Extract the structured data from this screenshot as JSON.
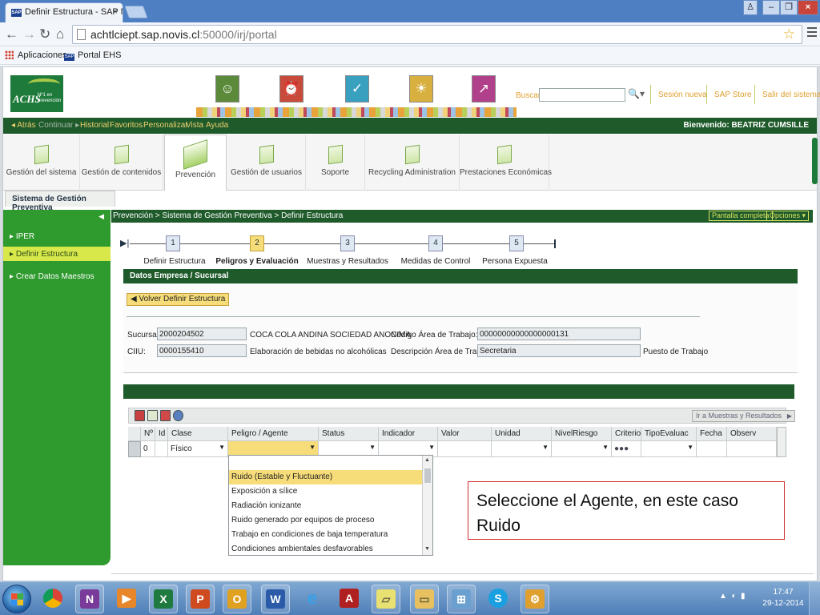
{
  "browser": {
    "tab_title": "Definir Estructura - SAP N",
    "tab_favicon": "SAP",
    "url_host": "achtlciept.sap.novis.cl",
    "url_rest": ":50000/irj/portal",
    "bookmarks": [
      {
        "label": "Aplicaciones",
        "icon": "apps-grid-icon"
      },
      {
        "label": "Portal EHS",
        "icon": "sap-logo-icon"
      }
    ]
  },
  "portal": {
    "logo_text": "ACHS",
    "logo_sub": "Nº1 en prevención",
    "search_label": "Buscar",
    "search_value": "",
    "header_links": [
      "Sesión nueva",
      "SAP Store",
      "Salir del sistema"
    ],
    "nav": [
      {
        "label": "Atrás",
        "dim": false
      },
      {
        "label": "Continuar",
        "dim": true
      },
      {
        "label": "Historial",
        "dim": false
      },
      {
        "label": "Favoritos",
        "dim": false
      },
      {
        "label": "Personalizar",
        "dim": false
      },
      {
        "label": "Vista",
        "dim": false
      },
      {
        "label": "Ayuda",
        "dim": false
      }
    ],
    "welcome": "Bienvenido: BEATRIZ CUMSILLE",
    "tools": [
      "Gestión del sistema",
      "Gestión de contenidos",
      "Prevención",
      "Gestión de usuarios",
      "Soporte",
      "Recycling Administration",
      "Prestaciones Económicas"
    ],
    "active_tool": "Prevención",
    "subtab": "Sistema de Gestión Preventiva"
  },
  "leftnav": {
    "items": [
      "IPER",
      "Definir Estructura",
      "Crear Datos Maestros"
    ],
    "selected": "Definir Estructura"
  },
  "content": {
    "breadcrumb": "Prevención  >  Sistema de Gestión Preventiva  >  Definir Estructura",
    "full_screen": "Pantalla completa",
    "options": "Opciones",
    "steps": [
      {
        "num": "1",
        "label": "Definir Estructura"
      },
      {
        "num": "2",
        "label": "Peligros y Evaluación"
      },
      {
        "num": "3",
        "label": "Muestras y Resultados"
      },
      {
        "num": "4",
        "label": "Medidas de Control"
      },
      {
        "num": "5",
        "label": "Persona Expuesta"
      }
    ],
    "current_step": "2",
    "section_title": "Datos Empresa / Sucursal",
    "back_button": "Volver Definir Estructura",
    "fields": {
      "sucursal_label": "Sucursal:",
      "sucursal_value": "2000204502",
      "sucursal_name": "COCA COLA ANDINA SOCIEDAD ANONIMA",
      "codigo_label": "Código Área de Trabajo:",
      "codigo_value": "00000000000000000131",
      "ciiu_label": "CIIU:",
      "ciiu_value": "0000155410",
      "ciiu_desc": "Elaboración de bebidas no alcohólicas",
      "desc_label": "Descripción Área de Trabajo:",
      "desc_value": "Secretaria",
      "puesto_label": "Puesto de Trabajo"
    },
    "go_button": "Ir a Muestras y Resultados",
    "table": {
      "headers": [
        "Nº",
        "Id",
        "Clase",
        "Peligro / Agente",
        "Status",
        "Indicador",
        "Valor",
        "Unidad",
        "NivelRiesgo",
        "Criterio",
        "TipoEvaluac",
        "Fecha",
        "Observ"
      ],
      "row": {
        "n": "0",
        "id": "",
        "clase": "Físico",
        "criterio": "●●●"
      }
    },
    "dropdown_options": [
      "Ruido (Estable y Fluctuante)",
      "Exposición a sílice",
      "Radiación ionizante",
      "Ruido generado por equipos de proceso",
      "Trabajo en condiciones de baja temperatura",
      "Condiciones ambientales desfavorables"
    ],
    "dropdown_highlight": "Ruido (Estable y Fluctuante)",
    "callout": "Seleccione el Agente, en este caso Ruido"
  },
  "taskbar": {
    "apps": [
      "chrome-icon",
      "onenote-icon",
      "media-player-icon",
      "excel-icon",
      "powerpoint-icon",
      "outlook-icon",
      "word-icon",
      "ie-icon",
      "acrobat-icon",
      "sticky-notes-icon",
      "file-explorer-icon",
      "network-icon",
      "skype-icon",
      "sap-gui-icon"
    ],
    "time": "17:47",
    "date": "29-12-2014"
  }
}
